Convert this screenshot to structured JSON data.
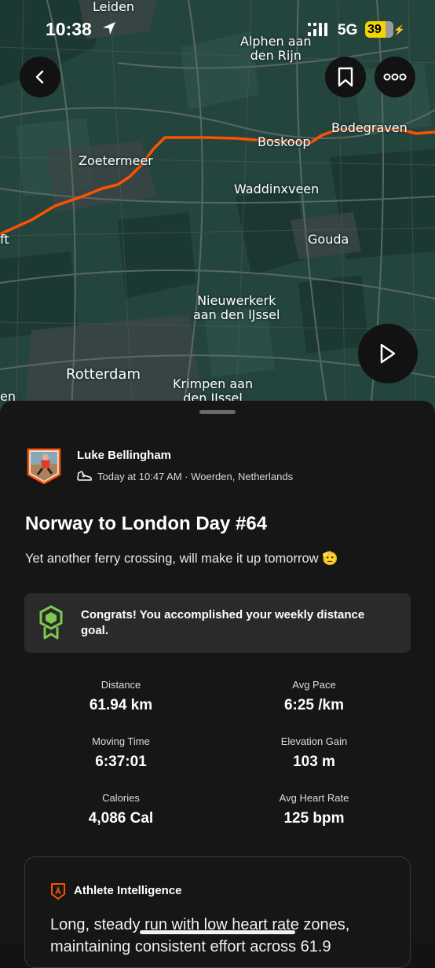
{
  "status_bar": {
    "time": "10:38",
    "network": "5G",
    "battery": "39"
  },
  "map": {
    "route_color": "#fc5200",
    "places": {
      "leiden": "Leiden",
      "alphen": [
        "Alphen aan",
        "den Rijn"
      ],
      "zoetermeer": "Zoetermeer",
      "boskoop": "Boskoop",
      "bodegraven": "Bodegraven",
      "waddinxveen": "Waddinxveen",
      "gouda": "Gouda",
      "nieuwerkerk": [
        "Nieuwerkerk",
        "aan den IJssel"
      ],
      "rotterdam": "Rotterdam",
      "krimpen": [
        "Krimpen aan",
        "den IJssel"
      ],
      "delft_partial": "ft",
      "den_partial": "en"
    }
  },
  "activity": {
    "athlete": "Luke Bellingham",
    "meta": "Today at 10:47 AM · Woerden, Netherlands",
    "title": "Norway to London Day #64",
    "description": "Yet another ferry crossing, will make it up tomorrow 🫡",
    "goal_message": "Congrats! You accomplished your weekly distance goal.",
    "stats": [
      {
        "label": "Distance",
        "value": "61.94 km"
      },
      {
        "label": "Avg Pace",
        "value": "6:25 /km"
      },
      {
        "label": "Moving Time",
        "value": "6:37:01"
      },
      {
        "label": "Elevation Gain",
        "value": "103 m"
      },
      {
        "label": "Calories",
        "value": "4,086 Cal"
      },
      {
        "label": "Avg Heart Rate",
        "value": "125 bpm"
      }
    ]
  },
  "athlete_intelligence": {
    "title": "Athlete Intelligence",
    "text": "Long, steady run with low heart rate zones, maintaining consistent effort across 61.9"
  },
  "colors": {
    "accent": "#fc5200",
    "goal_green": "#7ec850",
    "sheet_bg": "#161616",
    "map_bg": "#24453e"
  }
}
